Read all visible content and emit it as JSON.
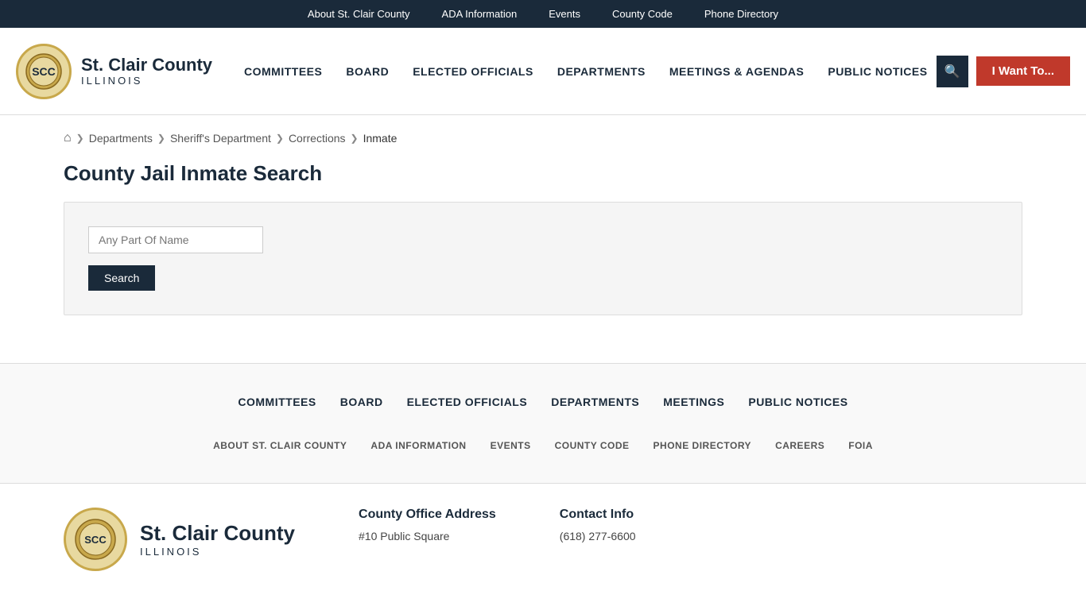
{
  "topbar": {
    "links": [
      {
        "label": "About St. Clair County",
        "name": "about-link"
      },
      {
        "label": "ADA Information",
        "name": "ada-link"
      },
      {
        "label": "Events",
        "name": "events-link"
      },
      {
        "label": "County Code",
        "name": "county-code-link"
      },
      {
        "label": "Phone Directory",
        "name": "phone-directory-link"
      }
    ]
  },
  "logo": {
    "county": "St. Clair County",
    "state": "ILLINOIS"
  },
  "mainnav": {
    "links": [
      {
        "label": "COMMITTEES",
        "name": "nav-committees"
      },
      {
        "label": "BOARD",
        "name": "nav-board"
      },
      {
        "label": "ELECTED OFFICIALS",
        "name": "nav-elected"
      },
      {
        "label": "DEPARTMENTS",
        "name": "nav-departments"
      },
      {
        "label": "MEETINGS & AGENDAS",
        "name": "nav-meetings"
      },
      {
        "label": "PUBLIC NOTICES",
        "name": "nav-notices"
      }
    ],
    "i_want_label": "I Want To..."
  },
  "breadcrumb": {
    "home_title": "Home",
    "items": [
      {
        "label": "Departments",
        "name": "breadcrumb-departments"
      },
      {
        "label": "Sheriff's Department",
        "name": "breadcrumb-sheriff"
      },
      {
        "label": "Corrections",
        "name": "breadcrumb-corrections"
      },
      {
        "label": "Inmate",
        "name": "breadcrumb-inmate"
      }
    ]
  },
  "page": {
    "title": "County Jail Inmate Search",
    "search_placeholder": "Any Part Of Name",
    "search_button": "Search"
  },
  "footer_nav": {
    "primary": [
      {
        "label": "COMMITTEES",
        "name": "footer-committees"
      },
      {
        "label": "BOARD",
        "name": "footer-board"
      },
      {
        "label": "ELECTED OFFICIALS",
        "name": "footer-elected"
      },
      {
        "label": "DEPARTMENTS",
        "name": "footer-departments"
      },
      {
        "label": "MEETINGS",
        "name": "footer-meetings"
      },
      {
        "label": "PUBLIC NOTICES",
        "name": "footer-notices"
      }
    ],
    "secondary": [
      {
        "label": "ABOUT ST. CLAIR COUNTY",
        "name": "footer-about"
      },
      {
        "label": "ADA INFORMATION",
        "name": "footer-ada"
      },
      {
        "label": "EVENTS",
        "name": "footer-events"
      },
      {
        "label": "COUNTY CODE",
        "name": "footer-county-code"
      },
      {
        "label": "PHONE DIRECTORY",
        "name": "footer-phone"
      },
      {
        "label": "CAREERS",
        "name": "footer-careers"
      },
      {
        "label": "FOIA",
        "name": "footer-foia"
      }
    ]
  },
  "footer": {
    "county": "St. Clair County",
    "state": "ILLINOIS",
    "address_title": "County Office Address",
    "address_line1": "#10 Public Square",
    "contact_title": "Contact Info",
    "contact_phone": "(618) 277-6600"
  }
}
